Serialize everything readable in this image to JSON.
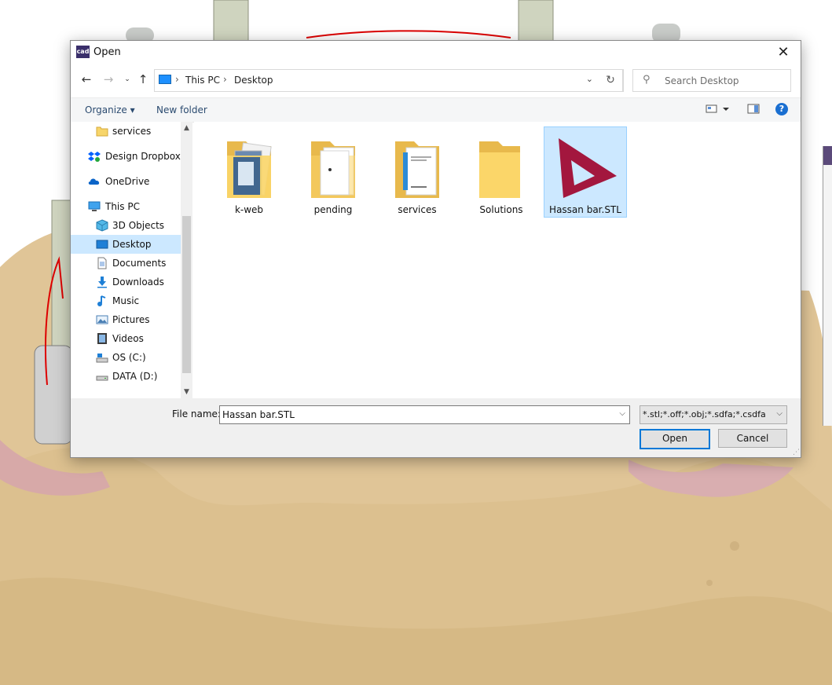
{
  "dialog": {
    "app_icon_text": "cad",
    "title": "Open",
    "close_glyph": "✕"
  },
  "address": {
    "crumbs": [
      "This PC",
      "Desktop"
    ],
    "search_placeholder": "Search Desktop"
  },
  "toolbar": {
    "organize": "Organize ▾",
    "new_folder": "New folder",
    "help": "?"
  },
  "navpane": {
    "items": [
      {
        "label": "services",
        "icon": "folder-icon"
      },
      {
        "label": "Design Dropbox",
        "icon": "dropbox-icon"
      },
      {
        "label": "OneDrive",
        "icon": "cloud-icon"
      },
      {
        "label": "This PC",
        "icon": "computer-icon"
      },
      {
        "label": "3D Objects",
        "icon": "cube-icon"
      },
      {
        "label": "Desktop",
        "icon": "desktop-icon",
        "selected": true
      },
      {
        "label": "Documents",
        "icon": "document-icon"
      },
      {
        "label": "Downloads",
        "icon": "download-icon"
      },
      {
        "label": "Music",
        "icon": "music-icon"
      },
      {
        "label": "Pictures",
        "icon": "picture-icon"
      },
      {
        "label": "Videos",
        "icon": "video-icon"
      },
      {
        "label": "OS (C:)",
        "icon": "drive-icon"
      },
      {
        "label": "DATA (D:)",
        "icon": "drive-icon"
      }
    ]
  },
  "files": [
    {
      "name": "k-web",
      "type": "folder"
    },
    {
      "name": "pending",
      "type": "folder"
    },
    {
      "name": "services",
      "type": "folder"
    },
    {
      "name": "Solutions",
      "type": "folder"
    },
    {
      "name": "Hassan bar.STL",
      "type": "stl",
      "selected": true
    }
  ],
  "bottom": {
    "file_name_label": "File name:",
    "file_name_value": "Hassan bar.STL",
    "filter_value": "*.stl;*.off;*.obj;*.sdfa;*.csdfa",
    "open_label": "Open",
    "cancel_label": "Cancel"
  },
  "colors": {
    "background_model": "#e0c597",
    "gum_pink": "#d7a9a8",
    "selection": "#cce8ff",
    "accent": "#0078d7",
    "stl_logo": "#a3173e"
  }
}
